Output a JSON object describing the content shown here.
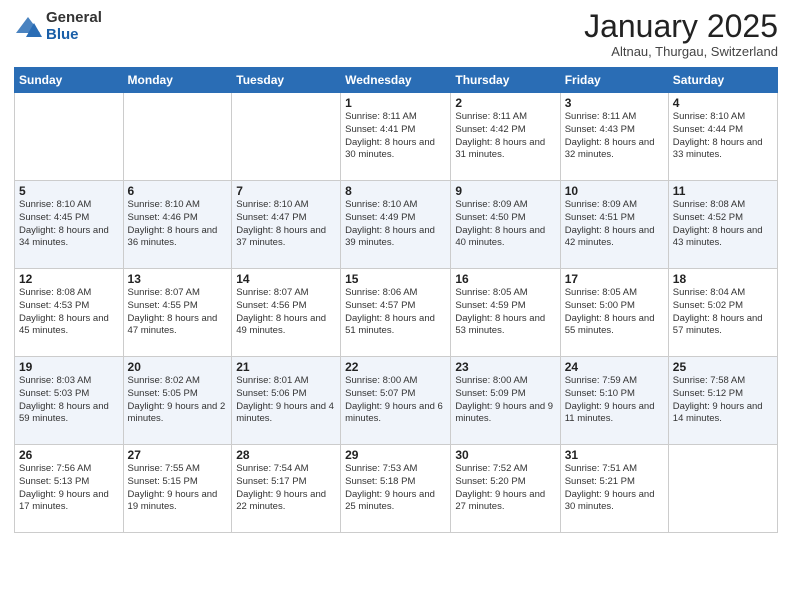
{
  "logo": {
    "general": "General",
    "blue": "Blue"
  },
  "header": {
    "month": "January 2025",
    "location": "Altnau, Thurgau, Switzerland"
  },
  "days_of_week": [
    "Sunday",
    "Monday",
    "Tuesday",
    "Wednesday",
    "Thursday",
    "Friday",
    "Saturday"
  ],
  "weeks": [
    [
      {
        "day": "",
        "sunrise": "",
        "sunset": "",
        "daylight": ""
      },
      {
        "day": "",
        "sunrise": "",
        "sunset": "",
        "daylight": ""
      },
      {
        "day": "",
        "sunrise": "",
        "sunset": "",
        "daylight": ""
      },
      {
        "day": "1",
        "sunrise": "Sunrise: 8:11 AM",
        "sunset": "Sunset: 4:41 PM",
        "daylight": "Daylight: 8 hours and 30 minutes."
      },
      {
        "day": "2",
        "sunrise": "Sunrise: 8:11 AM",
        "sunset": "Sunset: 4:42 PM",
        "daylight": "Daylight: 8 hours and 31 minutes."
      },
      {
        "day": "3",
        "sunrise": "Sunrise: 8:11 AM",
        "sunset": "Sunset: 4:43 PM",
        "daylight": "Daylight: 8 hours and 32 minutes."
      },
      {
        "day": "4",
        "sunrise": "Sunrise: 8:10 AM",
        "sunset": "Sunset: 4:44 PM",
        "daylight": "Daylight: 8 hours and 33 minutes."
      }
    ],
    [
      {
        "day": "5",
        "sunrise": "Sunrise: 8:10 AM",
        "sunset": "Sunset: 4:45 PM",
        "daylight": "Daylight: 8 hours and 34 minutes."
      },
      {
        "day": "6",
        "sunrise": "Sunrise: 8:10 AM",
        "sunset": "Sunset: 4:46 PM",
        "daylight": "Daylight: 8 hours and 36 minutes."
      },
      {
        "day": "7",
        "sunrise": "Sunrise: 8:10 AM",
        "sunset": "Sunset: 4:47 PM",
        "daylight": "Daylight: 8 hours and 37 minutes."
      },
      {
        "day": "8",
        "sunrise": "Sunrise: 8:10 AM",
        "sunset": "Sunset: 4:49 PM",
        "daylight": "Daylight: 8 hours and 39 minutes."
      },
      {
        "day": "9",
        "sunrise": "Sunrise: 8:09 AM",
        "sunset": "Sunset: 4:50 PM",
        "daylight": "Daylight: 8 hours and 40 minutes."
      },
      {
        "day": "10",
        "sunrise": "Sunrise: 8:09 AM",
        "sunset": "Sunset: 4:51 PM",
        "daylight": "Daylight: 8 hours and 42 minutes."
      },
      {
        "day": "11",
        "sunrise": "Sunrise: 8:08 AM",
        "sunset": "Sunset: 4:52 PM",
        "daylight": "Daylight: 8 hours and 43 minutes."
      }
    ],
    [
      {
        "day": "12",
        "sunrise": "Sunrise: 8:08 AM",
        "sunset": "Sunset: 4:53 PM",
        "daylight": "Daylight: 8 hours and 45 minutes."
      },
      {
        "day": "13",
        "sunrise": "Sunrise: 8:07 AM",
        "sunset": "Sunset: 4:55 PM",
        "daylight": "Daylight: 8 hours and 47 minutes."
      },
      {
        "day": "14",
        "sunrise": "Sunrise: 8:07 AM",
        "sunset": "Sunset: 4:56 PM",
        "daylight": "Daylight: 8 hours and 49 minutes."
      },
      {
        "day": "15",
        "sunrise": "Sunrise: 8:06 AM",
        "sunset": "Sunset: 4:57 PM",
        "daylight": "Daylight: 8 hours and 51 minutes."
      },
      {
        "day": "16",
        "sunrise": "Sunrise: 8:05 AM",
        "sunset": "Sunset: 4:59 PM",
        "daylight": "Daylight: 8 hours and 53 minutes."
      },
      {
        "day": "17",
        "sunrise": "Sunrise: 8:05 AM",
        "sunset": "Sunset: 5:00 PM",
        "daylight": "Daylight: 8 hours and 55 minutes."
      },
      {
        "day": "18",
        "sunrise": "Sunrise: 8:04 AM",
        "sunset": "Sunset: 5:02 PM",
        "daylight": "Daylight: 8 hours and 57 minutes."
      }
    ],
    [
      {
        "day": "19",
        "sunrise": "Sunrise: 8:03 AM",
        "sunset": "Sunset: 5:03 PM",
        "daylight": "Daylight: 8 hours and 59 minutes."
      },
      {
        "day": "20",
        "sunrise": "Sunrise: 8:02 AM",
        "sunset": "Sunset: 5:05 PM",
        "daylight": "Daylight: 9 hours and 2 minutes."
      },
      {
        "day": "21",
        "sunrise": "Sunrise: 8:01 AM",
        "sunset": "Sunset: 5:06 PM",
        "daylight": "Daylight: 9 hours and 4 minutes."
      },
      {
        "day": "22",
        "sunrise": "Sunrise: 8:00 AM",
        "sunset": "Sunset: 5:07 PM",
        "daylight": "Daylight: 9 hours and 6 minutes."
      },
      {
        "day": "23",
        "sunrise": "Sunrise: 8:00 AM",
        "sunset": "Sunset: 5:09 PM",
        "daylight": "Daylight: 9 hours and 9 minutes."
      },
      {
        "day": "24",
        "sunrise": "Sunrise: 7:59 AM",
        "sunset": "Sunset: 5:10 PM",
        "daylight": "Daylight: 9 hours and 11 minutes."
      },
      {
        "day": "25",
        "sunrise": "Sunrise: 7:58 AM",
        "sunset": "Sunset: 5:12 PM",
        "daylight": "Daylight: 9 hours and 14 minutes."
      }
    ],
    [
      {
        "day": "26",
        "sunrise": "Sunrise: 7:56 AM",
        "sunset": "Sunset: 5:13 PM",
        "daylight": "Daylight: 9 hours and 17 minutes."
      },
      {
        "day": "27",
        "sunrise": "Sunrise: 7:55 AM",
        "sunset": "Sunset: 5:15 PM",
        "daylight": "Daylight: 9 hours and 19 minutes."
      },
      {
        "day": "28",
        "sunrise": "Sunrise: 7:54 AM",
        "sunset": "Sunset: 5:17 PM",
        "daylight": "Daylight: 9 hours and 22 minutes."
      },
      {
        "day": "29",
        "sunrise": "Sunrise: 7:53 AM",
        "sunset": "Sunset: 5:18 PM",
        "daylight": "Daylight: 9 hours and 25 minutes."
      },
      {
        "day": "30",
        "sunrise": "Sunrise: 7:52 AM",
        "sunset": "Sunset: 5:20 PM",
        "daylight": "Daylight: 9 hours and 27 minutes."
      },
      {
        "day": "31",
        "sunrise": "Sunrise: 7:51 AM",
        "sunset": "Sunset: 5:21 PM",
        "daylight": "Daylight: 9 hours and 30 minutes."
      },
      {
        "day": "",
        "sunrise": "",
        "sunset": "",
        "daylight": ""
      }
    ]
  ]
}
